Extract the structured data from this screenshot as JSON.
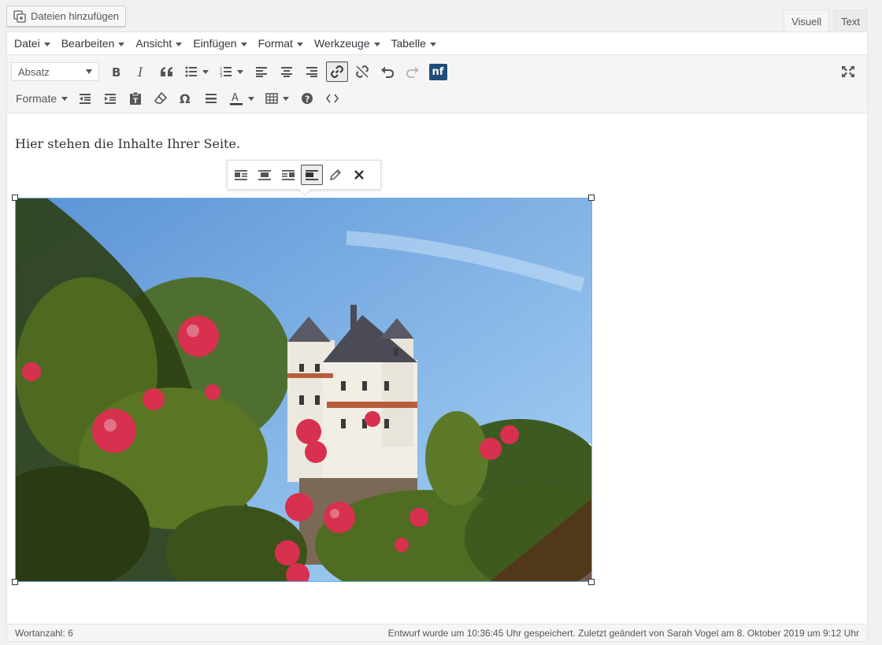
{
  "media": {
    "add_label": "Dateien hinzufügen"
  },
  "tabs": [
    {
      "label": "Visuell",
      "active": true
    },
    {
      "label": "Text",
      "active": false
    }
  ],
  "menubar": [
    {
      "label": "Datei"
    },
    {
      "label": "Bearbeiten"
    },
    {
      "label": "Ansicht"
    },
    {
      "label": "Einfügen"
    },
    {
      "label": "Format"
    },
    {
      "label": "Werkzeuge"
    },
    {
      "label": "Tabelle"
    }
  ],
  "toolbar": {
    "block_format": "Absatz",
    "formats_label": "Formate",
    "nf_label": "nf",
    "icons_row1": [
      "bold-icon",
      "italic-icon",
      "blockquote-icon",
      "bullet-list-icon",
      "numbered-list-icon",
      "align-left-icon",
      "align-center-icon",
      "align-right-icon",
      "link-icon",
      "unlink-icon",
      "undo-icon",
      "redo-icon",
      "ninja-forms-icon",
      "fullscreen-icon"
    ],
    "icons_row2": [
      "outdent-icon",
      "indent-icon",
      "paste-text-icon",
      "clear-formatting-icon",
      "special-character-icon",
      "horizontal-line-icon",
      "text-color-icon",
      "table-icon",
      "help-icon",
      "code-icon"
    ]
  },
  "content": {
    "paragraph": "Hier stehen die Inhalte Ihrer Seite."
  },
  "image_toolbar": {
    "icons": [
      "align-left-icon",
      "align-center-icon",
      "align-right-icon",
      "align-none-icon",
      "edit-icon",
      "remove-icon"
    ]
  },
  "colors": {
    "nf_bg": "#1f4e79",
    "sky_top": "#5b93d6",
    "sky_bottom": "#a9d4f5",
    "rose": "#d8304f",
    "foliage": "#3e5a1c"
  },
  "statusbar": {
    "word_count": "Wortanzahl: 6",
    "save_info": "Entwurf wurde um 10:36:45 Uhr gespeichert. Zuletzt geändert von Sarah Vogel am 8. Oktober 2019 um 9:12 Uhr"
  }
}
